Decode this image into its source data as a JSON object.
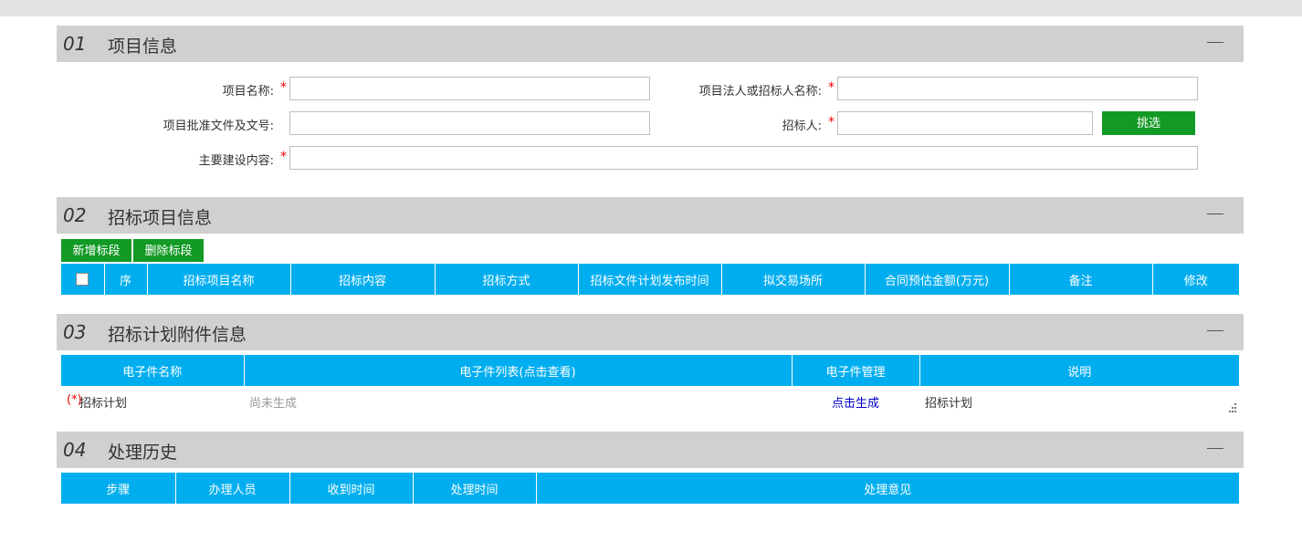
{
  "section1": {
    "num": "01",
    "title": "项目信息",
    "fields": {
      "project_name_label": "项目名称:",
      "legal_person_label": "项目法人或招标人名称:",
      "approval_doc_label": "项目批准文件及文号:",
      "tenderer_label": "招标人:",
      "construction_label": "主要建设内容:",
      "required_mark": "*",
      "select_button": "挑选"
    }
  },
  "section2": {
    "num": "02",
    "title": "招标项目信息",
    "add_button": "新增标段",
    "delete_button": "删除标段",
    "columns": [
      "序",
      "招标项目名称",
      "招标内容",
      "招标方式",
      "招标文件计划发布时间",
      "拟交易场所",
      "合同预估金额(万元)",
      "备注",
      "修改"
    ]
  },
  "section3": {
    "num": "03",
    "title": "招标计划附件信息",
    "columns": [
      "电子件名称",
      "电子件列表(点击查看)",
      "电子件管理",
      "说明"
    ],
    "row": {
      "required_prefix": "(*)",
      "name": "招标计划",
      "list": "尚未生成",
      "manage": "点击生成",
      "desc": "招标计划"
    }
  },
  "section4": {
    "num": "04",
    "title": "处理历史",
    "columns": [
      "步骤",
      "办理人员",
      "收到时间",
      "处理时间",
      "处理意见"
    ]
  },
  "colors": {
    "header": "#00aeef",
    "green_button": "#129a24",
    "section_bg": "#d0d0d0",
    "required": "#ee0000",
    "link": "#0000cc"
  }
}
